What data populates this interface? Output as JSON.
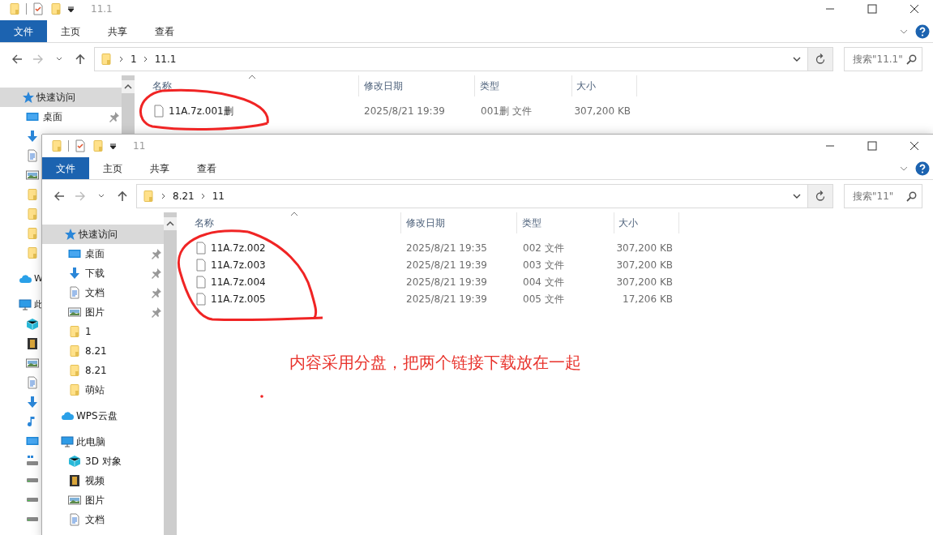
{
  "windows": [
    {
      "title": "11.1",
      "ribbon_tabs": [
        {
          "label": "文件",
          "selected": true
        },
        {
          "label": "主页",
          "selected": false
        },
        {
          "label": "共享",
          "selected": false
        },
        {
          "label": "查看",
          "selected": false
        }
      ],
      "path": [
        "1",
        "11.1"
      ],
      "search": {
        "placeholder": "搜索\"11.1\""
      },
      "nav": [
        {
          "label": "快速访问",
          "kind": "quick",
          "selected": true,
          "children": [
            {
              "label": "桌面",
              "kind": "desktop",
              "pinned": true,
              "selected": false
            },
            {
              "kind": "download",
              "selected": false
            },
            {
              "kind": "document",
              "selected": false
            },
            {
              "kind": "picture",
              "selected": false
            },
            {
              "kind": "folder",
              "selected": false
            },
            {
              "kind": "folder",
              "selected": false
            },
            {
              "kind": "folder",
              "selected": false
            },
            {
              "kind": "folder",
              "selected": false
            }
          ]
        },
        {
          "label": "W",
          "kind": "cloud",
          "selected": false
        },
        {
          "label": "此",
          "kind": "pc",
          "selected": false,
          "children": [
            {
              "kind": "cube",
              "selected": false
            },
            {
              "kind": "video",
              "selected": false
            },
            {
              "kind": "picture",
              "selected": false
            },
            {
              "kind": "document",
              "selected": false
            },
            {
              "kind": "download",
              "selected": false
            },
            {
              "kind": "music",
              "selected": false
            },
            {
              "kind": "desktop",
              "selected": false
            },
            {
              "kind": "netdrive",
              "selected": false
            },
            {
              "kind": "drive",
              "selected": false
            },
            {
              "kind": "drive",
              "selected": false
            },
            {
              "kind": "drive",
              "selected": false
            }
          ]
        }
      ],
      "columns": [
        "名称",
        "修改日期",
        "类型",
        "大小"
      ],
      "files": [
        {
          "name": "11A.7z.001删",
          "date": "2025/8/21 19:39",
          "type": "001删 文件",
          "size": "307,200 KB"
        }
      ]
    },
    {
      "title": "11",
      "ribbon_tabs": [
        {
          "label": "文件",
          "selected": true
        },
        {
          "label": "主页",
          "selected": false
        },
        {
          "label": "共享",
          "selected": false
        },
        {
          "label": "查看",
          "selected": false
        }
      ],
      "path": [
        "8.21",
        "11"
      ],
      "search": {
        "placeholder": "搜索\"11\""
      },
      "nav": [
        {
          "label": "快速访问",
          "kind": "quick",
          "selected": true,
          "children": [
            {
              "label": "桌面",
              "kind": "desktop",
              "pinned": true,
              "selected": false
            },
            {
              "label": "下载",
              "kind": "download",
              "pinned": true,
              "selected": false
            },
            {
              "label": "文档",
              "kind": "document",
              "pinned": true,
              "selected": false
            },
            {
              "label": "图片",
              "kind": "picture",
              "pinned": true,
              "selected": false
            },
            {
              "label": "1",
              "kind": "folder",
              "pinned": false,
              "selected": false
            },
            {
              "label": "8.21",
              "kind": "folder",
              "pinned": false,
              "selected": false
            },
            {
              "label": "8.21",
              "kind": "folder",
              "pinned": false,
              "selected": false
            },
            {
              "label": "萌站",
              "kind": "folder",
              "pinned": false,
              "selected": false
            }
          ]
        },
        {
          "label": "WPS云盘",
          "kind": "cloud",
          "selected": false
        },
        {
          "label": "此电脑",
          "kind": "pc",
          "selected": false,
          "children": [
            {
              "label": "3D 对象",
              "kind": "cube",
              "selected": false
            },
            {
              "label": "视频",
              "kind": "video",
              "selected": false
            },
            {
              "label": "图片",
              "kind": "picture",
              "selected": false
            },
            {
              "label": "文档",
              "kind": "document",
              "selected": false
            }
          ]
        }
      ],
      "columns": [
        "名称",
        "修改日期",
        "类型",
        "大小"
      ],
      "files": [
        {
          "name": "11A.7z.002",
          "date": "2025/8/21 19:35",
          "type": "002 文件",
          "size": "307,200 KB"
        },
        {
          "name": "11A.7z.003",
          "date": "2025/8/21 19:39",
          "type": "003 文件",
          "size": "307,200 KB"
        },
        {
          "name": "11A.7z.004",
          "date": "2025/8/21 19:39",
          "type": "004 文件",
          "size": "307,200 KB"
        },
        {
          "name": "11A.7z.005",
          "date": "2025/8/21 19:39",
          "type": "005 文件",
          "size": "17,206 KB"
        }
      ]
    }
  ],
  "annotation": {
    "text": "内容采用分盘，把两个链接下载放在一起"
  }
}
